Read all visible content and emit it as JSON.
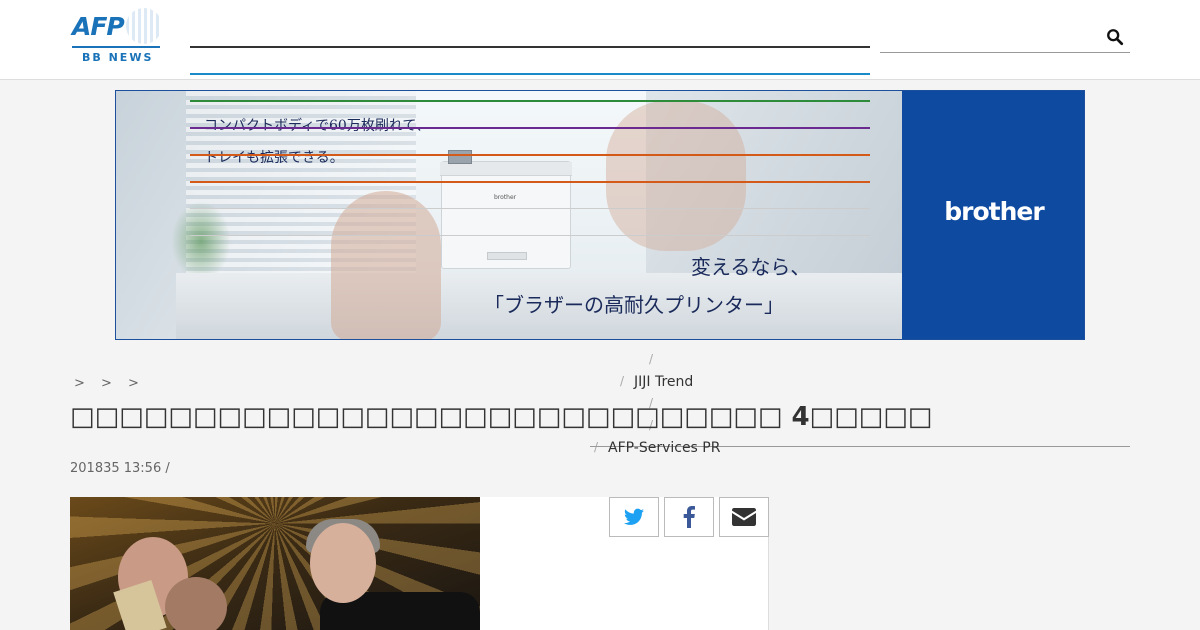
{
  "header": {
    "logo": {
      "brand": "AFP",
      "subtitle": "BB NEWS"
    },
    "search": {
      "placeholder": "",
      "value": ""
    }
  },
  "ad": {
    "line1": "コンパクトボディで60万枚刷れて、",
    "line2": "トレイも拡張できる。",
    "headline1": "変えるなら、",
    "headline2": "「ブラザーの高耐久プリンター」",
    "printer_brand": "brother",
    "brand": "brother",
    "colors": {
      "brand_panel": "#0d4aa0"
    }
  },
  "menu": {
    "items": [
      "JIJI Trend",
      "AFP-Services PR"
    ],
    "line_colors": [
      "#2e8b3a",
      "#6b2a8f",
      "#d45a1a",
      "#d45a1a"
    ]
  },
  "article": {
    "breadcrumbs": "> > >",
    "title": "□□□□□□□□□□□□□□□□□□□□□□□□□□□□□ 4□□□□□",
    "date": "201835 13:56  /"
  },
  "share": {
    "icons": [
      "twitter-icon",
      "facebook-icon",
      "mail-icon"
    ],
    "colors": {
      "twitter": "#1da1f2",
      "facebook": "#3b5998",
      "mail": "#333333"
    }
  }
}
